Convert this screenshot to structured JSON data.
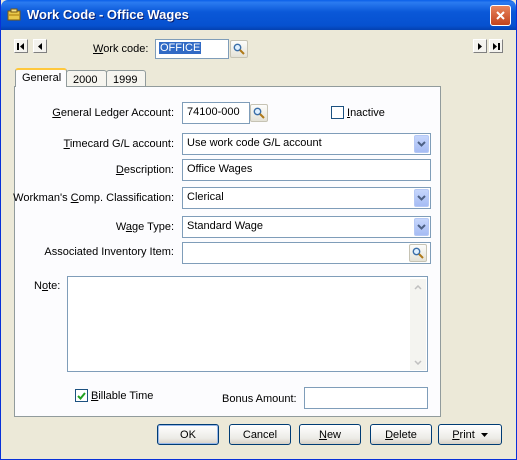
{
  "window": {
    "title": "Work Code - Office Wages"
  },
  "navigation": {
    "work_code_label": "Work code:",
    "work_code_value": "OFFICE"
  },
  "tabs": [
    {
      "label": "General",
      "active": true
    },
    {
      "label": "2000"
    },
    {
      "label": "1999"
    }
  ],
  "form": {
    "gl_account_label": "General Ledger Account:",
    "gl_account_value": "74100-000",
    "inactive_label": "Inactive",
    "inactive_checked": false,
    "timecard_gl_label": "Timecard G/L account:",
    "timecard_gl_value": "Use work code G/L account",
    "description_label": "Description:",
    "description_value": "Office Wages",
    "workmans_comp_label": "Workman's Comp. Classification:",
    "workmans_comp_value": "Clerical",
    "wage_type_label": "Wage Type:",
    "wage_type_value": "Standard Wage",
    "inventory_item_label": "Associated Inventory Item:",
    "inventory_item_value": "",
    "note_label": "Note:",
    "note_value": "",
    "billable_label": "Billable Time",
    "billable_checked": true,
    "bonus_label": "Bonus Amount:",
    "bonus_value": ""
  },
  "buttons": {
    "ok": "OK",
    "cancel": "Cancel",
    "new": "New",
    "delete": "Delete",
    "print": "Print"
  },
  "colors": {
    "title_bar": "#0a58d8",
    "close_button": "#c2431d",
    "dialog_bg": "#ece9d8",
    "tab_highlight": "#ffc83c",
    "field_border": "#7f9db9"
  }
}
